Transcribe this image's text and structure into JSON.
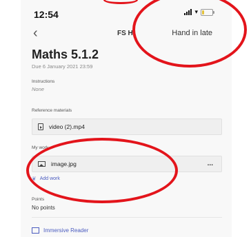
{
  "status_bar": {
    "time": "12:54"
  },
  "nav": {
    "title": "FS H",
    "action_label": "Hand in late"
  },
  "assignment": {
    "title": "Maths 5.1.2",
    "due": "Due 6 January 2021 23:59",
    "instructions_label": "Instructions",
    "instructions_value": "None",
    "reference_label": "Reference materials",
    "reference_file": "video (2).mp4",
    "my_work_label": "My work",
    "my_work_file": "image.jpg",
    "more_label": "...",
    "add_work_label": "Add work",
    "points_label": "Points",
    "points_value": "No points",
    "immersive_reader_label": "Immersive Reader"
  },
  "annotations": {
    "color": "#e3141b"
  }
}
